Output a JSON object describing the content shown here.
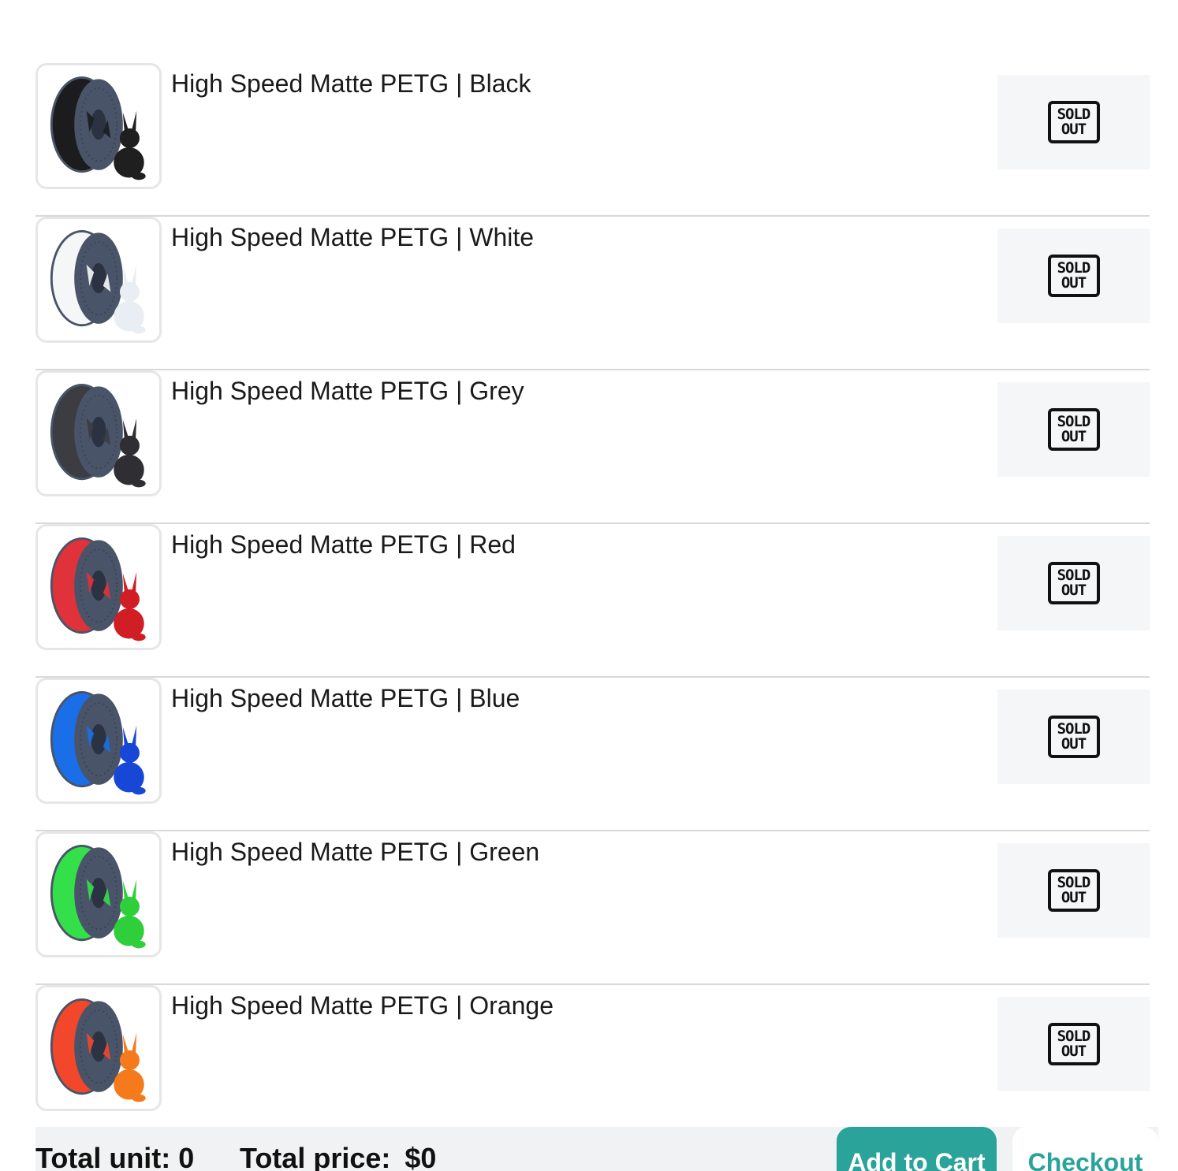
{
  "products": [
    {
      "name": "High Speed Matte PETG | Black",
      "status": [
        "SOLD",
        "OUT"
      ],
      "color": "#1c1c1e",
      "bunny": "#1f1f1f"
    },
    {
      "name": "High Speed Matte PETG | White",
      "status": [
        "SOLD",
        "OUT"
      ],
      "color": "#f4f6f8",
      "bunny": "#e9eef4"
    },
    {
      "name": "High Speed Matte PETG | Grey",
      "status": [
        "SOLD",
        "OUT"
      ],
      "color": "#3b3d42",
      "bunny": "#2f2f33"
    },
    {
      "name": "High Speed Matte PETG | Red",
      "status": [
        "SOLD",
        "OUT"
      ],
      "color": "#e0323a",
      "bunny": "#d11d24"
    },
    {
      "name": "High Speed Matte PETG | Blue",
      "status": [
        "SOLD",
        "OUT"
      ],
      "color": "#1a6ee8",
      "bunny": "#1747d6"
    },
    {
      "name": "High Speed Matte PETG | Green",
      "status": [
        "SOLD",
        "OUT"
      ],
      "color": "#33e04a",
      "bunny": "#2fcf3c"
    },
    {
      "name": "High Speed Matte PETG | Orange",
      "status": [
        "SOLD",
        "OUT"
      ],
      "color": "#f2472b",
      "bunny": "#f57a1c"
    }
  ],
  "footer": {
    "total_unit_label": "Total unit: 0",
    "total_price_label": "Total price:",
    "total_price_value": "$0",
    "add_to_cart_label": "Add to Cart",
    "checkout_label": "Checkout"
  },
  "theme": {
    "accent": "#2aa39a",
    "spool_frame": "#4a5468"
  }
}
